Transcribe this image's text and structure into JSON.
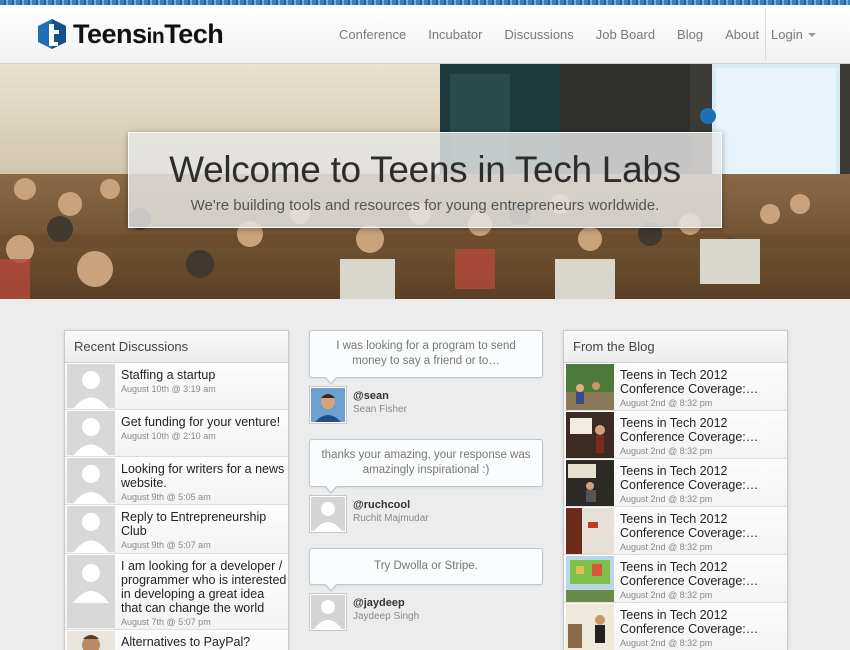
{
  "brand": {
    "name_part1": "Teens",
    "name_part2": "in",
    "name_part3": "Tech",
    "logo_icon": "teens-in-tech-logo",
    "colors": {
      "logo_blue": "#1f6fb5",
      "stripe_blue": "#3a7fc0"
    }
  },
  "nav": {
    "items": [
      "Conference",
      "Incubator",
      "Discussions",
      "Job Board",
      "Blog",
      "About"
    ],
    "login_label": "Login"
  },
  "hero": {
    "title": "Welcome to Teens in Tech Labs",
    "subtitle": "We're building tools and resources for young entrepreneurs worldwide."
  },
  "discussions": {
    "heading": "Recent Discussions",
    "items": [
      {
        "title": "Staffing a startup",
        "date": "August 10th @ 3:19 am",
        "avatar": "default-avatar"
      },
      {
        "title": "Get funding for your venture!",
        "date": "August 10th @ 2:10 am",
        "avatar": "default-avatar"
      },
      {
        "title": "Looking for writers for a news website.",
        "date": "August 9th @ 5:05 am",
        "avatar": "default-avatar"
      },
      {
        "title": "Reply to Entrepreneurship Club",
        "date": "August 9th @ 5:07 am",
        "avatar": "default-avatar"
      },
      {
        "title": "I am looking for a developer / programmer who is interested in developing a great idea that can change the world",
        "date": "August 7th @ 5:07 pm",
        "avatar": "default-avatar"
      },
      {
        "title": "Alternatives to PayPal?",
        "date": "",
        "avatar": "user-photo"
      }
    ]
  },
  "tweets": [
    {
      "text": "I was looking for a program to send money to say a friend or to…",
      "handle": "@sean",
      "name": "Sean Fisher",
      "avatar": "user-photo"
    },
    {
      "text": "thanks your amazing, your response was amazingly inspirational :)",
      "handle": "@ruchcool",
      "name": "Ruchit Majmudar",
      "avatar": "default-avatar"
    },
    {
      "text": "Try Dwolla or Stripe.",
      "handle": "@jaydeep",
      "name": "Jaydeep Singh",
      "avatar": "default-avatar"
    }
  ],
  "blog": {
    "heading": "From the Blog",
    "items": [
      {
        "title": "Teens in Tech 2012 Conference Coverage:…",
        "date": "August 2nd @ 8:32 pm",
        "thumb": "outdoor-photo"
      },
      {
        "title": "Teens in Tech 2012 Conference Coverage:…",
        "date": "August 2nd @ 8:32 pm",
        "thumb": "stage-photo"
      },
      {
        "title": "Teens in Tech 2012 Conference Coverage:…",
        "date": "August 2nd @ 8:32 pm",
        "thumb": "stage-photo"
      },
      {
        "title": "Teens in Tech 2012 Conference Coverage:…",
        "date": "August 2nd @ 8:32 pm",
        "thumb": "presentation-photo"
      },
      {
        "title": "Teens in Tech 2012 Conference Coverage:…",
        "date": "August 2nd @ 8:32 pm",
        "thumb": "slide-photo"
      },
      {
        "title": "Teens in Tech 2012 Conference Coverage:…",
        "date": "August 2nd @ 8:32 pm",
        "thumb": "stage-photo"
      }
    ]
  }
}
